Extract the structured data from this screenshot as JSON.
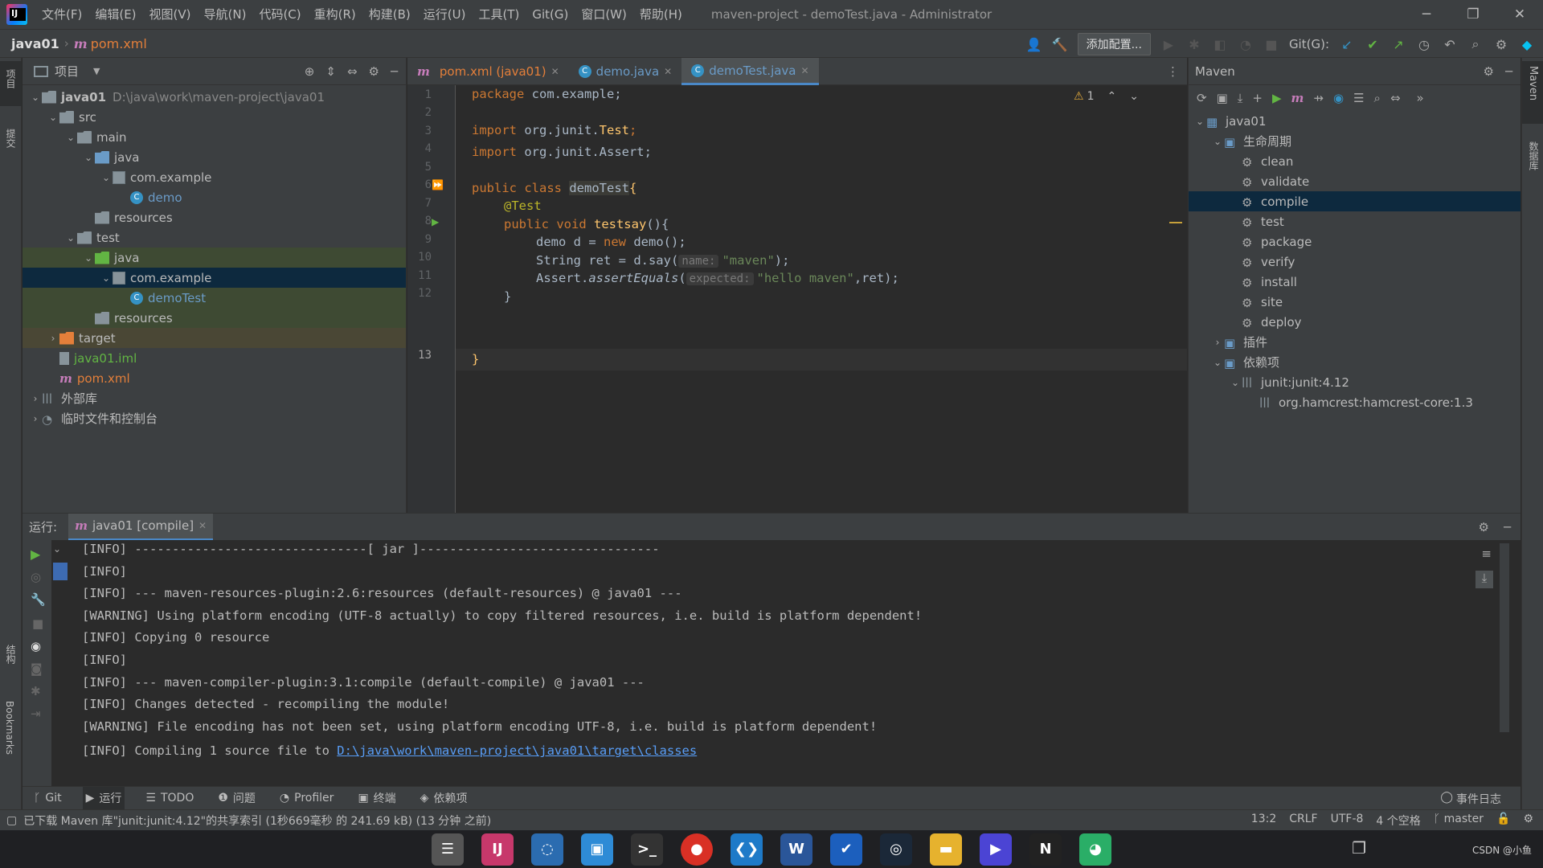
{
  "menu": [
    "文件(F)",
    "编辑(E)",
    "视图(V)",
    "导航(N)",
    "代码(C)",
    "重构(R)",
    "构建(B)",
    "运行(U)",
    "工具(T)",
    "Git(G)",
    "窗口(W)",
    "帮助(H)"
  ],
  "window_title": "maven-project - demoTest.java - Administrator",
  "nav": {
    "project": "java01",
    "file": "pom.xml",
    "add_config": "添加配置...",
    "git_label": "Git(G):"
  },
  "project_panel": {
    "title": "项目",
    "rows": [
      {
        "indent": 0,
        "arrow": "v",
        "icon": "folder",
        "label": "java01",
        "path": "D:\\java\\work\\maven-project\\java01",
        "bold": true
      },
      {
        "indent": 1,
        "arrow": "v",
        "icon": "folder",
        "label": "src"
      },
      {
        "indent": 2,
        "arrow": "v",
        "icon": "folder",
        "label": "main"
      },
      {
        "indent": 3,
        "arrow": "v",
        "icon": "folder-blue",
        "label": "java"
      },
      {
        "indent": 4,
        "arrow": "v",
        "icon": "package",
        "label": "com.example"
      },
      {
        "indent": 5,
        "arrow": "",
        "icon": "class",
        "label": "demo",
        "color": "#6a9bc7"
      },
      {
        "indent": 3,
        "arrow": "",
        "icon": "folder-res",
        "label": "resources"
      },
      {
        "indent": 2,
        "arrow": "v",
        "icon": "folder",
        "label": "test"
      },
      {
        "indent": 3,
        "arrow": "v",
        "icon": "folder-green",
        "label": "java",
        "sel": "green"
      },
      {
        "indent": 4,
        "arrow": "v",
        "icon": "package",
        "label": "com.example",
        "sel": "dark"
      },
      {
        "indent": 5,
        "arrow": "",
        "icon": "class",
        "label": "demoTest",
        "color": "#6a9bc7",
        "sel": "green"
      },
      {
        "indent": 3,
        "arrow": "",
        "icon": "folder-res",
        "label": "resources",
        "sel": "green"
      },
      {
        "indent": 1,
        "arrow": ">",
        "icon": "folder-orange",
        "label": "target",
        "sel": "olive"
      },
      {
        "indent": 1,
        "arrow": "",
        "icon": "iml",
        "label": "java01.iml",
        "color": "#62b543"
      },
      {
        "indent": 1,
        "arrow": "",
        "icon": "maven",
        "label": "pom.xml",
        "color": "#e47f3a"
      },
      {
        "indent": 0,
        "arrow": ">",
        "icon": "lib",
        "label": "外部库"
      },
      {
        "indent": 0,
        "arrow": ">",
        "icon": "scratch",
        "label": "临时文件和控制台"
      }
    ]
  },
  "tabs": [
    {
      "label": "pom.xml (java01)",
      "icon": "maven",
      "color": "#e47f3a"
    },
    {
      "label": "demo.java",
      "icon": "class",
      "color": "#6a9bc7"
    },
    {
      "label": "demoTest.java",
      "icon": "class",
      "color": "#6a9bc7",
      "active": true
    }
  ],
  "editor": {
    "warning_count": "1",
    "lines": [
      "1",
      "2",
      "3",
      "4",
      "5",
      "6",
      "7",
      "8",
      "9",
      "10",
      "11",
      "12",
      "13"
    ],
    "hint_name": "name:",
    "hint_expected": "expected:",
    "code": {
      "l1a": "package",
      "l1b": " com.example;",
      "l3a": "import",
      "l3b": " org.junit.",
      "l3c": "Test",
      ";": ";",
      "l4a": "import",
      "l4b": " org.junit.Assert;",
      "l6a": "public class ",
      "l6b": "demoTest",
      "l6c": "{",
      "l7": "@Test",
      "l8a": "public void ",
      "l8b": "testsay",
      "l8c": "(){",
      "l9a": "demo d = ",
      "l9b": "new ",
      "l9c": "demo();",
      "l10a": "String ret = d.say(",
      "l10b": "\"maven\"",
      "l10c": ");",
      "l11a": "Assert.",
      "l11b": "assertEquals",
      "l11c": "(",
      "l11d": "\"hello maven\"",
      "l11e": ",ret);",
      "l12": "}",
      "l13": "}"
    }
  },
  "maven": {
    "title": "Maven",
    "rows": [
      {
        "indent": 0,
        "arrow": "v",
        "icon": "module",
        "label": "java01"
      },
      {
        "indent": 1,
        "arrow": "v",
        "icon": "lifecycle",
        "label": "生命周期"
      },
      {
        "indent": 2,
        "arrow": "",
        "icon": "gear",
        "label": "clean"
      },
      {
        "indent": 2,
        "arrow": "",
        "icon": "gear",
        "label": "validate"
      },
      {
        "indent": 2,
        "arrow": "",
        "icon": "gear",
        "label": "compile",
        "sel": true
      },
      {
        "indent": 2,
        "arrow": "",
        "icon": "gear",
        "label": "test"
      },
      {
        "indent": 2,
        "arrow": "",
        "icon": "gear",
        "label": "package"
      },
      {
        "indent": 2,
        "arrow": "",
        "icon": "gear",
        "label": "verify"
      },
      {
        "indent": 2,
        "arrow": "",
        "icon": "gear",
        "label": "install"
      },
      {
        "indent": 2,
        "arrow": "",
        "icon": "gear",
        "label": "site"
      },
      {
        "indent": 2,
        "arrow": "",
        "icon": "gear",
        "label": "deploy"
      },
      {
        "indent": 1,
        "arrow": ">",
        "icon": "plugins",
        "label": "插件"
      },
      {
        "indent": 1,
        "arrow": "v",
        "icon": "deps",
        "label": "依赖项"
      },
      {
        "indent": 2,
        "arrow": "v",
        "icon": "lib",
        "label": "junit:junit:4.12"
      },
      {
        "indent": 3,
        "arrow": "",
        "icon": "lib",
        "label": "org.hamcrest:hamcrest-core:1.3"
      }
    ]
  },
  "run": {
    "label": "运行:",
    "tab": "java01 [compile]",
    "lines": [
      "[INFO] -------------------------------[ jar ]--------------------------------",
      "[INFO]",
      "[INFO] --- maven-resources-plugin:2.6:resources (default-resources) @ java01 ---",
      "[WARNING] Using platform encoding (UTF-8 actually) to copy filtered resources, i.e. build is platform dependent!",
      "[INFO] Copying 0 resource",
      "[INFO]",
      "[INFO] --- maven-compiler-plugin:3.1:compile (default-compile) @ java01 ---",
      "[INFO] Changes detected - recompiling the module!",
      "[WARNING] File encoding has not been set, using platform encoding UTF-8, i.e. build is platform dependent!"
    ],
    "last_prefix": "[INFO] Compiling 1 source file to ",
    "last_link": "D:\\java\\work\\maven-project\\java01\\target\\classes"
  },
  "toolwindows": [
    "Git",
    "运行",
    "TODO",
    "问题",
    "Profiler",
    "终端",
    "依赖项"
  ],
  "event_log": "事件日志",
  "status": {
    "message": "已下载 Maven 库\"junit:junit:4.12\"的共享索引 (1秒669毫秒 的 241.69 kB) (13 分钟 之前)",
    "pos": "13:2",
    "eol": "CRLF",
    "enc": "UTF-8",
    "indent": "4 个空格",
    "branch": "master"
  },
  "left_stripe": {
    "project": "项目",
    "commit": "提交",
    "structure": "结构",
    "bookmarks": "Bookmarks"
  },
  "right_stripe": {
    "maven": "Maven",
    "db": "数据库"
  },
  "watermark": "CSDN @小鱼"
}
